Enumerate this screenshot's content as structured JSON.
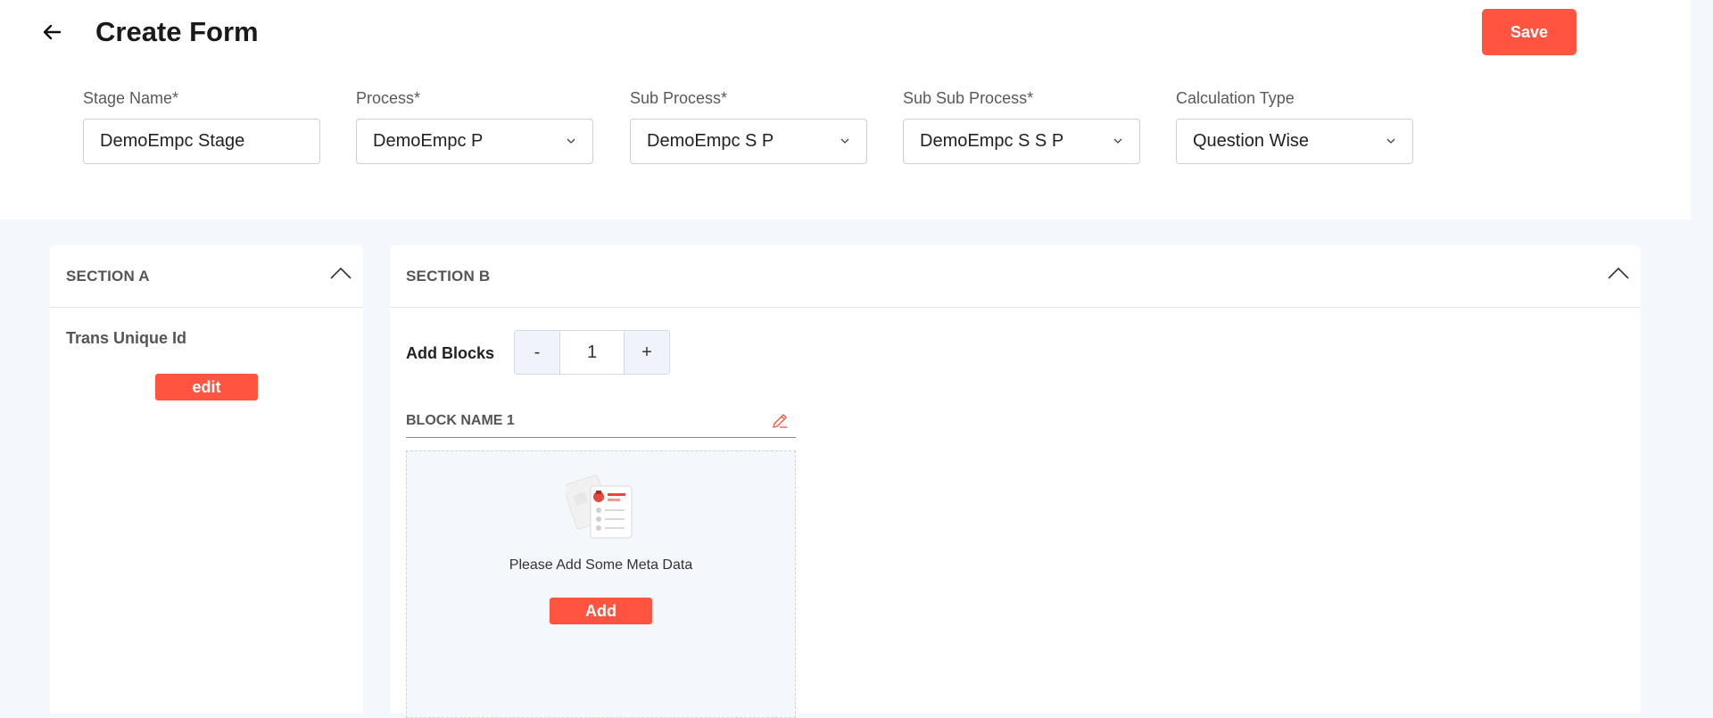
{
  "header": {
    "title": "Create Form",
    "save_label": "Save",
    "back_icon": "arrow-left-icon"
  },
  "fields": [
    {
      "label": "Stage Name*",
      "value": "DemoEmpc Stage",
      "type": "text"
    },
    {
      "label": "Process*",
      "value": "DemoEmpc P",
      "type": "select"
    },
    {
      "label": "Sub Process*",
      "value": "DemoEmpc S P",
      "type": "select"
    },
    {
      "label": "Sub Sub Process*",
      "value": "DemoEmpc S S P",
      "type": "select"
    },
    {
      "label": "Calculation Type",
      "value": "Question Wise",
      "type": "select"
    }
  ],
  "section_a": {
    "title": "SECTION A",
    "field_name": "Trans Unique Id",
    "edit_label": "edit"
  },
  "section_b": {
    "title": "SECTION B",
    "add_blocks_label": "Add Blocks",
    "minus_label": "-",
    "plus_label": "+",
    "block_count": "1",
    "block": {
      "name": "BLOCK NAME 1",
      "empty_message": "Please Add Some Meta Data",
      "add_label": "Add"
    }
  },
  "colors": {
    "accent": "#ff5440",
    "page_bg": "#f4f7fb",
    "panel_bg": "#ffffff"
  }
}
